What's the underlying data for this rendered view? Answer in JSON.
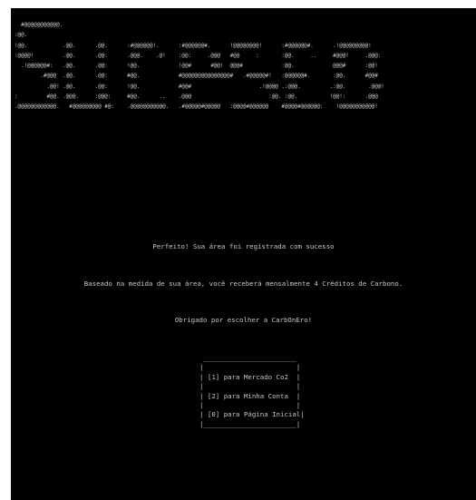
{
  "banner_lines": [
    "  #@@@@@@@@@@@.",
    ":@@.",
    "!@@.           .@@.      .@@.      :#@@@@@@!.      :#@@@@@@#.      !@@@@@@@@!      :#@@@@@@#.      .!@@@@@@@@@!",
    ":@@@@!         .@@.      .@@:      .@@@.    .@!    :@@:     .@@@   #@@     :       :@@.     ..     #@@@!     .@@@:",
    "  .!@@@@@@#:   .@@.      .@@:      !@@.            !@@#      #@@!  @@@#            :@@.            @@@#      :@@!",
    "        .#@@@  .@@.      .@@:      #@@.            #@@@@@@@@@@@@@@@#   .#@@@@@#!   :@@@@@@#.       :@@.      #@@#",
    "          .@@! .@@.      .@@:      !@@.            #@@#                     .!@@@@ .:@@@.         .:@@.       .@@@!",
    ":         #@@. .@@@.     :@@@:     #@@.      ..    .@@@                        :@@. :@@.          !@@!:      .@@@",
    ".@@@@@@@@@@@@.   #@@@@@@@@@ #@:    .@@@@@@@@@@@.   .#@@@@@#@@@@@   :@@@@#@@@@@@    #@@@@#@@@@@@:    !@@@@@@@@@@@!"
  ],
  "messages": {
    "success": "Perfeito! Sua área foi registrada com sucesso",
    "credits": "Baseado na medida de sua área, você receberá mensalmente 4 Créditos de Carbono.",
    "thanks": "Obrigado por escolher a CarbOnEro!"
  },
  "menu": {
    "top": " _______________________",
    "blank": "|                       |",
    "bottom": "|_______________________|",
    "items": [
      "[1] para Mercado Co2",
      "[2] para Minha Conta",
      "[0] para Página Inicial"
    ]
  }
}
